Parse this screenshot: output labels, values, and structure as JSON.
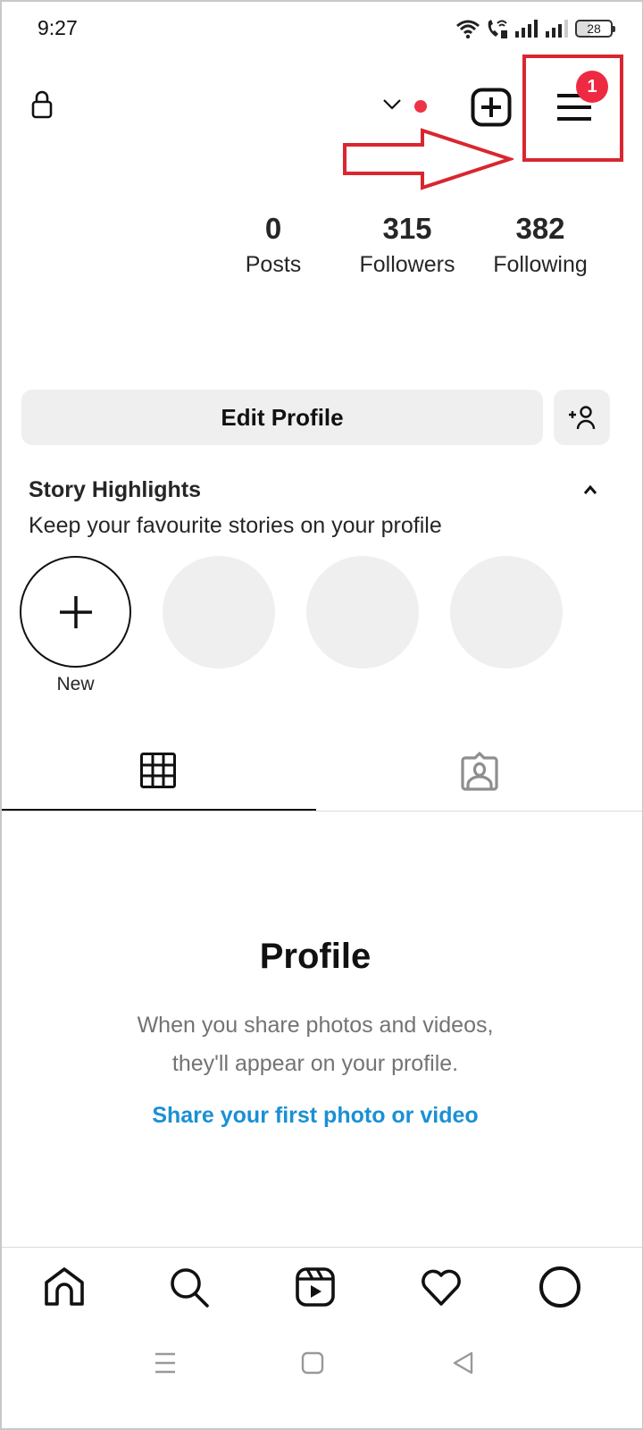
{
  "status_bar": {
    "time": "9:27",
    "icons": [
      "wifi-icon",
      "wifi-call-icon",
      "signal-sim1-icon",
      "signal-sim2-icon"
    ],
    "battery": "28"
  },
  "top_bar": {
    "lock_icon": "lock-icon",
    "account_switcher_icon": "chevron-down-icon",
    "new_post_icon": "plus-square-icon",
    "menu_icon": "hamburger-menu-icon",
    "menu_badge": "1"
  },
  "annotation": {
    "arrow": "right-arrow-annotation",
    "highlight": "highlight-box-annotation"
  },
  "stats": [
    {
      "value": "0",
      "label": "Posts"
    },
    {
      "value": "315",
      "label": "Followers"
    },
    {
      "value": "382",
      "label": "Following"
    }
  ],
  "actions": {
    "edit_profile": "Edit Profile",
    "discover_people_icon": "add-person-icon"
  },
  "story_highlights": {
    "title": "Story Highlights",
    "subtitle": "Keep your favourite stories on your profile",
    "new_label": "New",
    "placeholder_count": 3
  },
  "tabs": [
    {
      "name": "grid",
      "icon": "grid-icon",
      "active": true
    },
    {
      "name": "tagged",
      "icon": "tagged-person-icon",
      "active": false
    }
  ],
  "empty_state": {
    "title": "Profile",
    "line1": "When you share photos and videos,",
    "line2": "they'll appear on your profile.",
    "link": "Share your first photo or video"
  },
  "bottom_nav": [
    {
      "name": "home",
      "icon": "home-icon"
    },
    {
      "name": "search",
      "icon": "search-icon"
    },
    {
      "name": "reels",
      "icon": "reels-icon"
    },
    {
      "name": "activity",
      "icon": "heart-icon"
    },
    {
      "name": "profile",
      "icon": "profile-avatar-icon"
    }
  ],
  "system_nav": [
    {
      "name": "recents",
      "icon": "recents-icon"
    },
    {
      "name": "home",
      "icon": "home-square-icon"
    },
    {
      "name": "back",
      "icon": "back-triangle-icon"
    }
  ],
  "colors": {
    "annotation_red": "#d9262f",
    "badge_red": "#ee2a43",
    "dot_red": "#ef3347",
    "link_blue": "#1a90d4",
    "button_gray": "#efefef",
    "muted_text": "#737373"
  }
}
